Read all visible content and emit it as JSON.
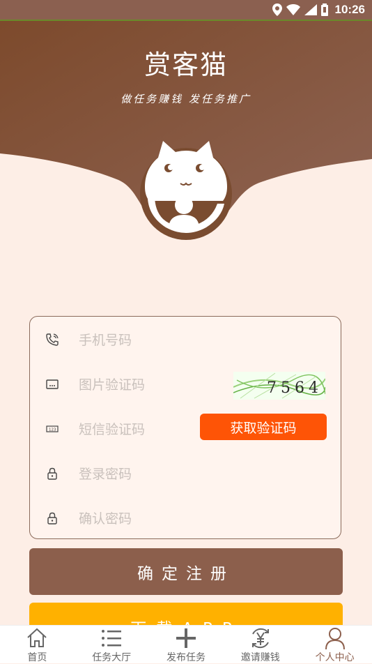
{
  "status_bar": {
    "time": "10:26"
  },
  "header": {
    "title": "赏客猫",
    "slogan": "做任务赚钱 发任务推广"
  },
  "form": {
    "phone_placeholder": "手机号码",
    "captcha_placeholder": "图片验证码",
    "captcha_code": "7564",
    "sms_placeholder": "短信验证码",
    "sms_button_label": "获取验证码",
    "password_placeholder": "登录密码",
    "confirm_placeholder": "确认密码"
  },
  "buttons": {
    "register_label": "确定注册",
    "download_label": "下载APP"
  },
  "nav": {
    "items": [
      {
        "label": "首页",
        "icon": "home-icon"
      },
      {
        "label": "任务大厅",
        "icon": "list-icon"
      },
      {
        "label": "发布任务",
        "icon": "plus-icon"
      },
      {
        "label": "邀请赚钱",
        "icon": "yen-icon"
      },
      {
        "label": "个人中心",
        "icon": "person-icon"
      }
    ],
    "active_index": 4
  },
  "colors": {
    "brand_brown": "#8c5f4c",
    "accent_orange": "#fe5406",
    "download_yellow": "#ffb100",
    "background": "#fdeee6"
  }
}
